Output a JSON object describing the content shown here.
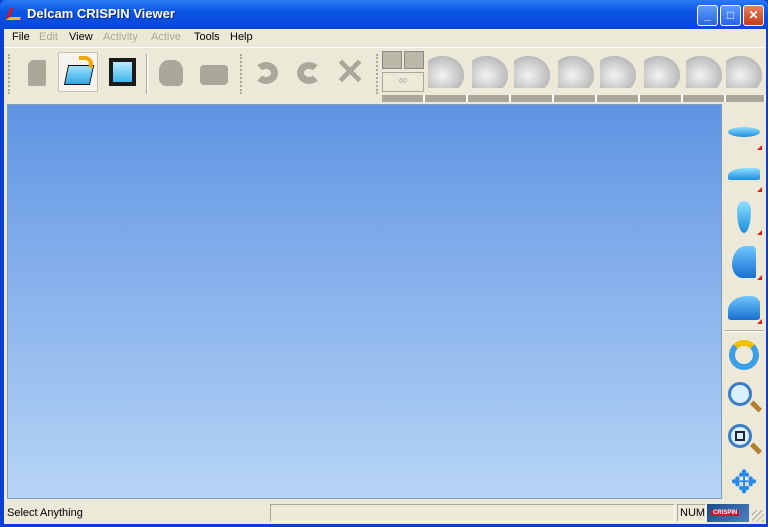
{
  "window": {
    "title": "Delcam CRISPIN Viewer"
  },
  "menu": [
    {
      "label": "File",
      "enabled": true
    },
    {
      "label": "Edit",
      "enabled": false
    },
    {
      "label": "View",
      "enabled": true
    },
    {
      "label": "Activity",
      "enabled": false
    },
    {
      "label": "Active",
      "enabled": false
    },
    {
      "label": "Tools",
      "enabled": true
    },
    {
      "label": "Help",
      "enabled": true
    }
  ],
  "toolbar": {
    "buttons": [
      "new-icon",
      "open-folder-icon",
      "save-icon",
      "last-icon",
      "bottom-icon",
      "undo-icon",
      "redo-icon",
      "delete-icon"
    ],
    "stages": [
      "last-stage-icon",
      "sandal-design-icon",
      "sandal-icon",
      "boot-icon",
      "upper-icon",
      "shoe-icon",
      "heel-icon",
      "components-icon"
    ]
  },
  "right_toolbar": [
    "insole-view-icon",
    "side-view-icon",
    "top-view-icon",
    "back-view-icon",
    "iso-view-icon",
    "rotate-icon",
    "zoom-icon",
    "zoom-window-icon",
    "pan-icon"
  ],
  "colors": {
    "viewport_top": "#5f94e3",
    "viewport_bottom": "#b7d5f6",
    "titlebar": "#0a55e4"
  },
  "status": {
    "text": "Select Anything",
    "num": "NUM",
    "logo": "CRISPIN"
  }
}
